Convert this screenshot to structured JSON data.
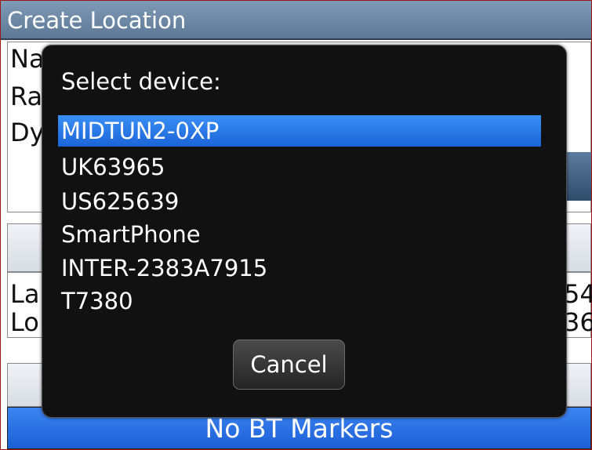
{
  "window": {
    "title": "Create Location"
  },
  "background": {
    "row1_partial": "Na",
    "row2_partial": "Ra",
    "row3_partial": "Dy",
    "lat_label_partial": "La",
    "lon_label_partial": "Lo",
    "lat_value_partial": "54",
    "lon_value_partial": "36",
    "bottom_status": "No BT Markers"
  },
  "dialog": {
    "title": "Select device:",
    "devices": [
      {
        "label": "MIDTUN2-0XP",
        "selected": true
      },
      {
        "label": "UK63965",
        "selected": false
      },
      {
        "label": "US625639",
        "selected": false
      },
      {
        "label": "SmartPhone",
        "selected": false
      },
      {
        "label": "INTER-2383A7915",
        "selected": false
      },
      {
        "label": "T7380",
        "selected": false
      }
    ],
    "cancel_label": "Cancel"
  },
  "colors": {
    "title_bar": "#6f8aa6",
    "selection": "#2a78ea",
    "dialog_bg": "#111111",
    "status_bar": "#2b72e6"
  }
}
